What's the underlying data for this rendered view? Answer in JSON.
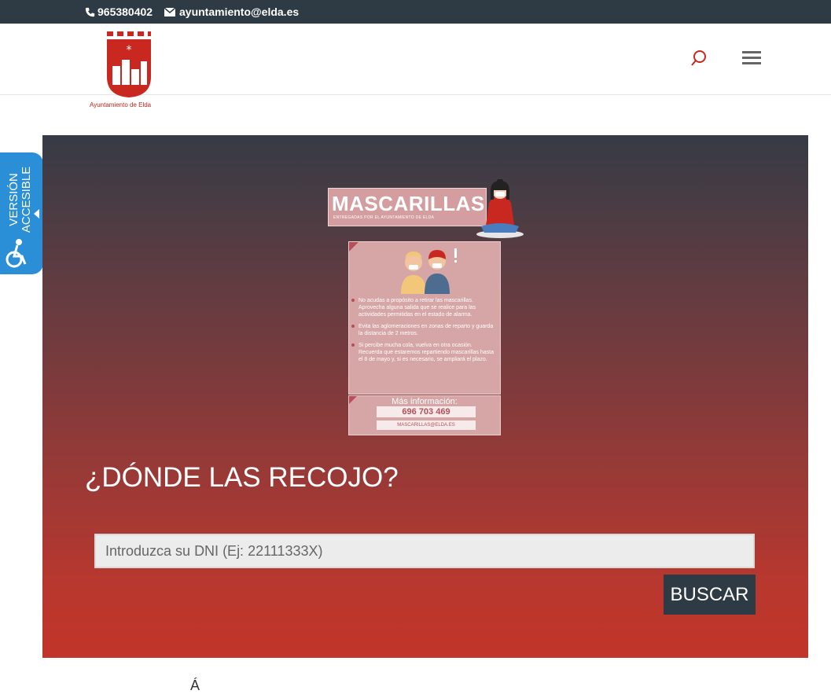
{
  "topbar": {
    "phone": "965380402",
    "email": "ayuntamiento@elda.es"
  },
  "header": {
    "logo_caption": "Ayuntamiento de Elda"
  },
  "accessibility": {
    "line1": "VERSIÓN",
    "line2": "ACCESIBLE"
  },
  "poster": {
    "title": "MASCARILLAS",
    "subtitle": "ENTREGADAS POR EL AYUNTAMIENTO DE ELDA",
    "bullets": [
      "No acudas a propósito a retirar las mascarillas. Aprovecha alguna salida que se realice para las actividades permitidas en el estado de alarma.",
      "Evita las aglomeraciones en zonas de reparto y guarda la distancia de 2 metros.",
      "Si percibe mucha cola, vuelva en otra ocasión. Recuerda que estaremos repartiendo mascarillas hasta el 8 de mayo y, si es necesario, se ampliará el plazo."
    ],
    "more_info": "Más información:",
    "info_phone": "696 703 469",
    "info_email": "MASCARILLAS@ELDA.ES"
  },
  "hero": {
    "heading": "¿DÓNDE LAS RECOJO?",
    "dni_placeholder": "Introduzca su DNI (Ej: 22111333X)",
    "dni_value": "",
    "search_button": "BUSCAR"
  },
  "footer": {
    "partial_char": "Á"
  },
  "colors": {
    "topbar": "#2e3b44",
    "brand_red": "#c23429",
    "accessible_blue": "#2a8fd6"
  },
  "icons": [
    "phone-icon",
    "envelope-icon",
    "search-icon",
    "menu-icon",
    "wheelchair-icon",
    "arrow-left-icon"
  ]
}
